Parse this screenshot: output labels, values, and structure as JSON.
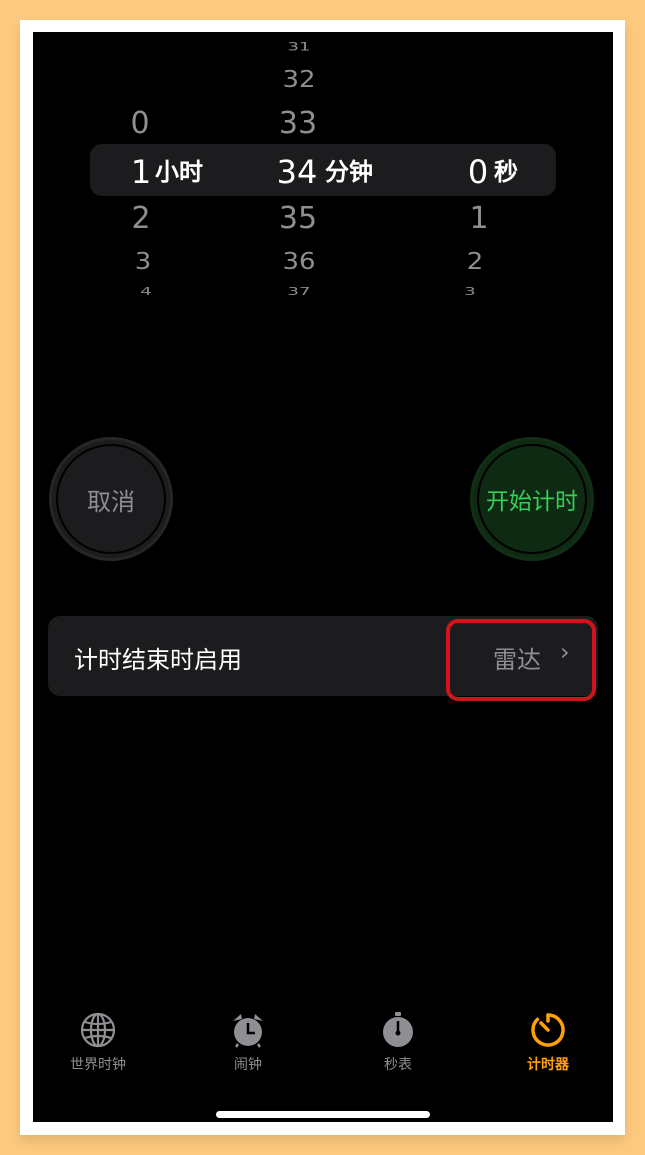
{
  "picker": {
    "hours": {
      "above": [
        "0"
      ],
      "selected": "1",
      "unit": "小时",
      "below": [
        "2",
        "3",
        "4"
      ]
    },
    "minutes": {
      "above": [
        "31",
        "32",
        "33"
      ],
      "selected": "34",
      "unit": "分钟",
      "below": [
        "35",
        "36",
        "37"
      ]
    },
    "seconds": {
      "selected": "0",
      "unit": "秒",
      "below": [
        "1",
        "2",
        "3"
      ]
    }
  },
  "buttons": {
    "cancel_label": "取消",
    "start_label": "开始计时"
  },
  "timer_end_row": {
    "label": "计时结束时启用",
    "value": "雷达"
  },
  "tab_bar": {
    "tabs": [
      {
        "label": "世界时钟",
        "icon": "globe-icon"
      },
      {
        "label": "闹钟",
        "icon": "alarm-clock-icon"
      },
      {
        "label": "秒表",
        "icon": "stopwatch-icon"
      },
      {
        "label": "计时器",
        "icon": "timer-icon",
        "active": true
      }
    ],
    "active_color": "#FF9F0A",
    "inactive_color": "#8E8E93"
  }
}
